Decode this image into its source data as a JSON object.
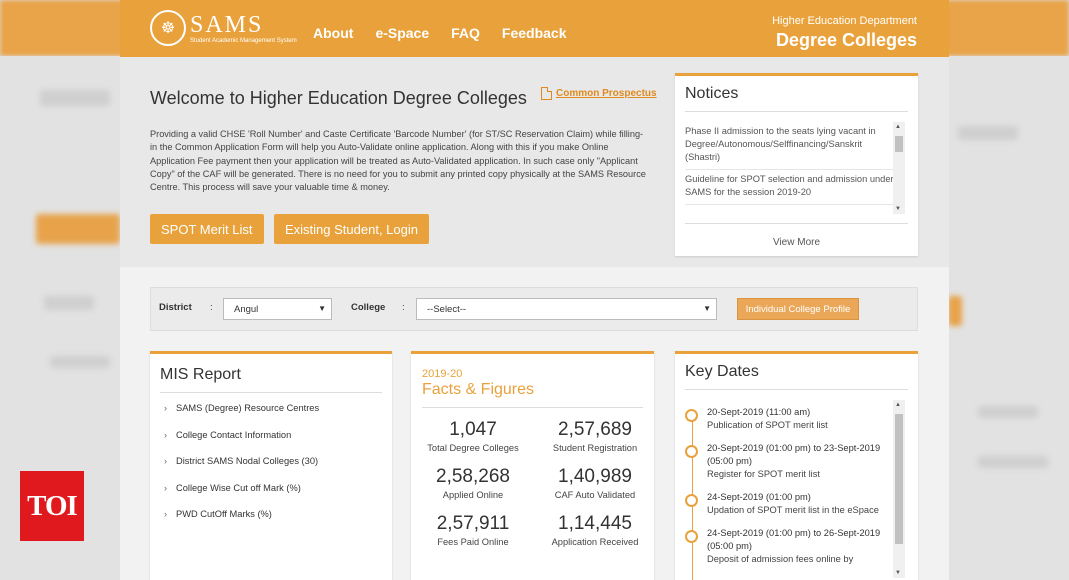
{
  "header": {
    "logo_text": "SAMS",
    "logo_subtitle": "Student Academic Management System",
    "nav": [
      "About",
      "e-Space",
      "FAQ",
      "Feedback"
    ],
    "dept_line1": "Higher Education Department",
    "dept_line2": "Degree Colleges"
  },
  "hero": {
    "title": "Welcome to Higher Education Degree Colleges",
    "prospectus_link": "Common Prospectus",
    "intro": "Providing a valid CHSE 'Roll Number' and Caste Certificate 'Barcode Number' (for ST/SC Reservation Claim) while filling-in the Common Application Form will help you Auto-Validate online application. Along with this if you make Online Application Fee payment then your application will be treated as Auto-Validated application. In such case only \"Applicant Copy\" of the CAF will be generated. There is no need for you to submit any printed copy physically at the SAMS Resource Centre. This process will save your valuable time & money.",
    "btn_spot": "SPOT Merit List",
    "btn_login": "Existing Student, Login"
  },
  "notices": {
    "title": "Notices",
    "items": [
      "Phase II admission to the seats lying vacant in Degree/Autonomous/Selffinancing/Sanskrit (Shastri)",
      "Guideline for SPOT selection and admission under SAMS for the session 2019-20"
    ],
    "view_more": "View More"
  },
  "filter": {
    "district_label": "District",
    "district_value": "Angul",
    "college_label": "College",
    "college_value": "--Select--",
    "profile_button": "Individual College Profile",
    "colon": ":"
  },
  "mis": {
    "title": "MIS Report",
    "items": [
      "SAMS (Degree) Resource Centres",
      "College Contact Information",
      "District SAMS Nodal Colleges (30)",
      "College Wise Cut off Mark (%)",
      "PWD CutOff Marks (%)"
    ]
  },
  "facts": {
    "year": "2019-20",
    "title": "Facts & Figures",
    "stats": [
      {
        "num": "1,047",
        "cap": "Total Degree Colleges"
      },
      {
        "num": "2,57,689",
        "cap": "Student Registration"
      },
      {
        "num": "2,58,268",
        "cap": "Applied Online"
      },
      {
        "num": "1,40,989",
        "cap": "CAF Auto Validated"
      },
      {
        "num": "2,57,911",
        "cap": "Fees Paid Online"
      },
      {
        "num": "1,14,445",
        "cap": "Application Received"
      }
    ]
  },
  "keydates": {
    "title": "Key Dates",
    "items": [
      {
        "date": "20-Sept-2019 (11:00 am)",
        "desc": "Publication of SPOT merit list"
      },
      {
        "date": "20-Sept-2019 (01:00 pm) to 23-Sept-2019 (05:00 pm)",
        "desc": "Register for SPOT merit list"
      },
      {
        "date": "24-Sept-2019 (01:00 pm)",
        "desc": "Updation of SPOT merit list in the eSpace"
      },
      {
        "date": "24-Sept-2019 (01:00 pm) to 26-Sept-2019 (05:00 pm)",
        "desc": "Deposit of admission fees online by"
      }
    ]
  },
  "watermark": "TOI"
}
